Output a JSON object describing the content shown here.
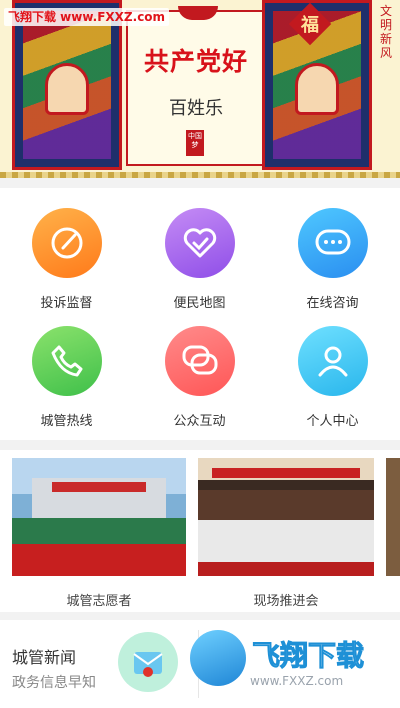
{
  "banner": {
    "watermark": "飞翔下载 www.FXXZ.com",
    "slogan": "共产党好",
    "sub_slogan": "百姓乐",
    "fu_char": "福",
    "side_text": "文明新风",
    "seal_text": "中国梦"
  },
  "grid": {
    "items": [
      {
        "label": "投诉监督",
        "icon": "edit-icon",
        "color": "#ff8a2a"
      },
      {
        "label": "便民地图",
        "icon": "heart-icon",
        "color": "#a46cf0"
      },
      {
        "label": "在线咨询",
        "icon": "chat-bubble-icon",
        "color": "#35a8f5"
      },
      {
        "label": "城管热线",
        "icon": "phone-icon",
        "color": "#55cd58"
      },
      {
        "label": "公众互动",
        "icon": "messages-icon",
        "color": "#ff6a6a"
      },
      {
        "label": "个人中心",
        "icon": "user-icon",
        "color": "#3cc4f4"
      }
    ]
  },
  "photos": {
    "items": [
      {
        "caption": "城管志愿者"
      },
      {
        "caption": "现场推进会"
      },
      {
        "caption": ""
      }
    ]
  },
  "news": {
    "title": "城管新闻",
    "subtitle": "政务信息早知"
  },
  "watermark_bottom": {
    "brand": "飞翔下载",
    "url": "www.FXXZ.com"
  }
}
